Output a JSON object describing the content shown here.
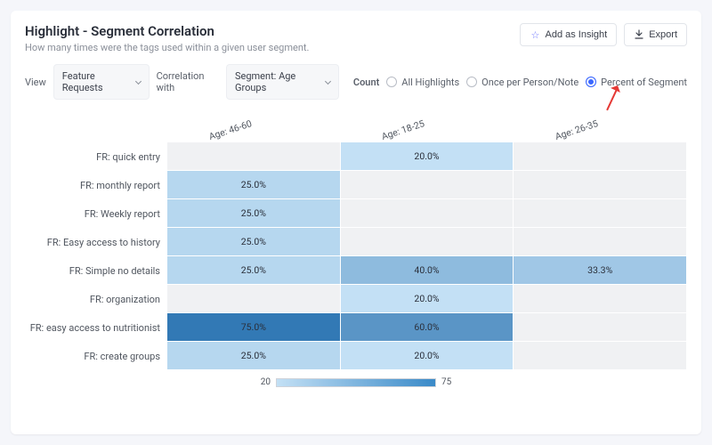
{
  "header": {
    "title": "Highlight - Segment Correlation",
    "subtitle": "How many times were the tags used within a given user segment.",
    "actions": {
      "insight": "Add as Insight",
      "export": "Export"
    }
  },
  "controls": {
    "view_label": "View",
    "view_value": "Feature Requests",
    "corr_label": "Correlation with",
    "corr_value": "Segment: Age Groups",
    "count_label": "Count",
    "radios": {
      "all": "All Highlights",
      "once": "Once per Person/Note",
      "pct": "Percent of Segment"
    },
    "selected_radio": "pct"
  },
  "chart_data": {
    "type": "heatmap",
    "xlabel": "",
    "ylabel": "",
    "columns": [
      "Age: 46-60",
      "Age: 18-25",
      "Age: 26-35"
    ],
    "rows": [
      "FR: quick entry",
      "FR: monthly report",
      "FR: Weekly report",
      "FR: Easy access to history",
      "FR: Simple no details",
      "FR: organization",
      "FR: easy access to nutritionist",
      "FR: create groups"
    ],
    "values": [
      [
        null,
        20.0,
        null
      ],
      [
        25.0,
        null,
        null
      ],
      [
        25.0,
        null,
        null
      ],
      [
        25.0,
        null,
        null
      ],
      [
        25.0,
        40.0,
        33.3
      ],
      [
        null,
        20.0,
        null
      ],
      [
        75.0,
        60.0,
        null
      ],
      [
        25.0,
        20.0,
        null
      ]
    ],
    "value_suffix": "%",
    "legend": {
      "min": 20,
      "max": 75
    },
    "empty_color": "#f0f1f3",
    "colorscale_low": "#c3e0f5",
    "colorscale_high": "#3279b5"
  }
}
